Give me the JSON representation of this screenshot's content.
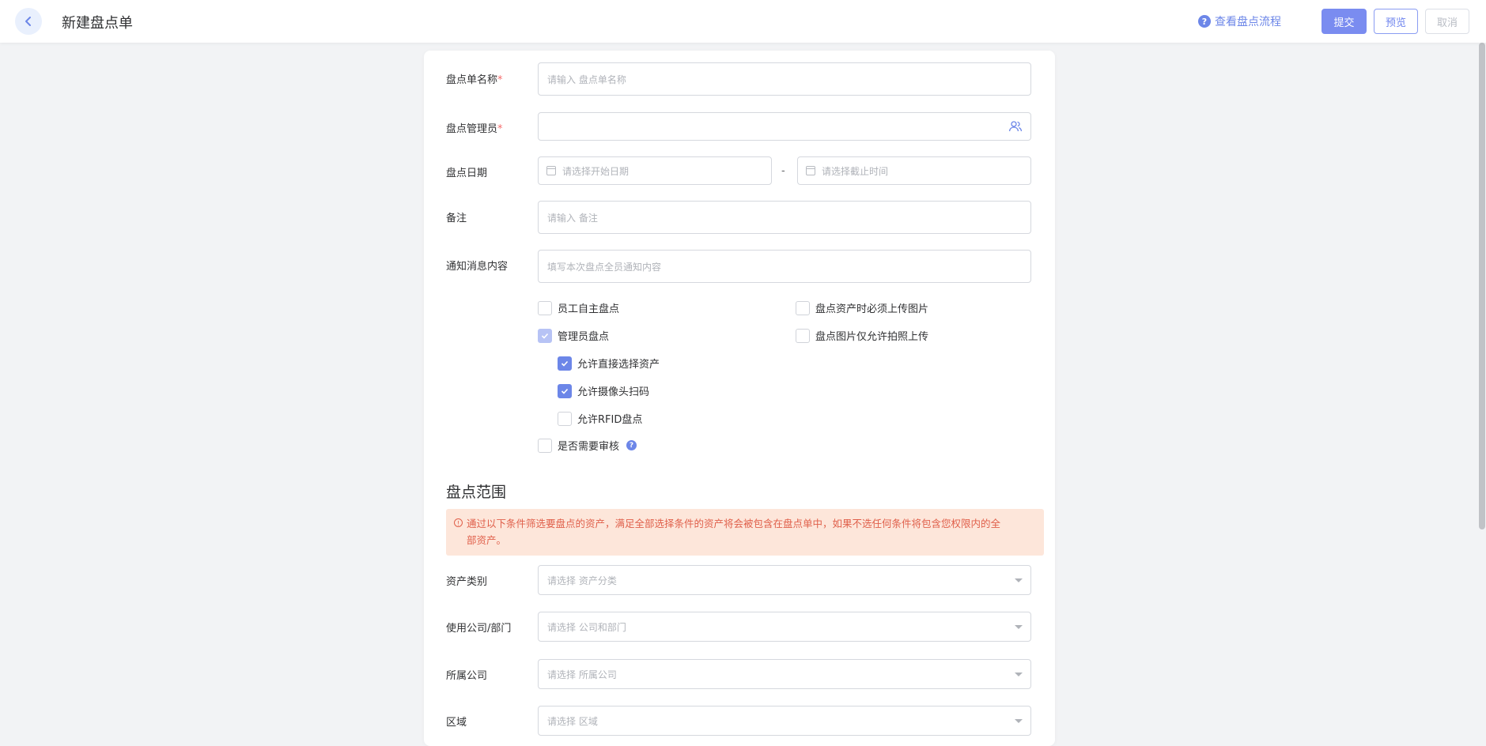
{
  "header": {
    "title": "新建盘点单",
    "flow_link": "查看盘点流程",
    "submit_label": "提交",
    "preview_label": "预览",
    "cancel_label": "取消"
  },
  "form": {
    "name": {
      "label": "盘点单名称",
      "required": "*",
      "placeholder": "请输入 盘点单名称",
      "value": ""
    },
    "manager": {
      "label": "盘点管理员",
      "required": "*",
      "value": ""
    },
    "date": {
      "label": "盘点日期",
      "start_placeholder": "请选择开始日期",
      "separator": "-",
      "end_placeholder": "请选择截止时间"
    },
    "remark": {
      "label": "备注",
      "placeholder": "请输入 备注"
    },
    "notice": {
      "label": "通知消息内容",
      "placeholder": "填写本次盘点全员通知内容"
    }
  },
  "options": {
    "employee_self": {
      "label": "员工自主盘点",
      "checked": false
    },
    "manager_count": {
      "label": "管理员盘点",
      "checked": "indeterminate"
    },
    "allow_direct_select": {
      "label": "允许直接选择资产",
      "checked": true
    },
    "allow_camera_scan": {
      "label": "允许摄像头扫码",
      "checked": true
    },
    "allow_rfid": {
      "label": "允许RFID盘点",
      "checked": false
    },
    "need_review": {
      "label": "是否需要审核",
      "checked": false
    },
    "must_upload_image": {
      "label": "盘点资产时必须上传图片",
      "checked": false
    },
    "photo_only": {
      "label": "盘点图片仅允许拍照上传",
      "checked": false
    }
  },
  "scope": {
    "title": "盘点范围",
    "alert_line1": "通过以下条件筛选要盘点的资产，满足全部选择条件的资产将会被包含在盘点单中，如果不选任何条件将包含您权限内的全",
    "alert_line2": "部资产。",
    "category": {
      "label": "资产类别",
      "placeholder": "请选择 资产分类"
    },
    "dept": {
      "label": "使用公司/部门",
      "placeholder": "请选择 公司和部门"
    },
    "company": {
      "label": "所属公司",
      "placeholder": "请选择 所属公司"
    },
    "area": {
      "label": "区域",
      "placeholder": "请选择 区域"
    }
  },
  "colors": {
    "accent": "#6c86e8",
    "required": "#f56c6c",
    "alert_bg": "#fde6da",
    "alert_text": "#e0604b"
  },
  "icons": {
    "back": "chevron-left-icon",
    "help": "question-circle-icon",
    "users": "users-icon",
    "calendar": "calendar-icon",
    "info": "exclamation-circle-icon"
  }
}
